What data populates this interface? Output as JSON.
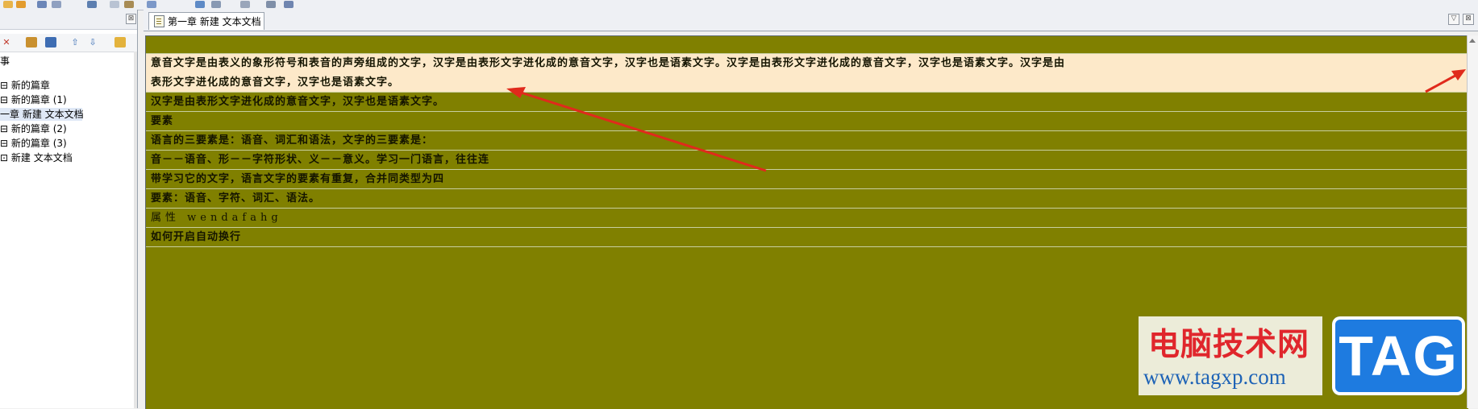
{
  "left_panel": {
    "close_label": "⊠",
    "tree": [
      {
        "label": "事",
        "selected": false
      },
      {
        "label": "新的篇章",
        "selected": false
      },
      {
        "label": "新的篇章 (1)",
        "selected": false
      },
      {
        "label": "一章 新建 文本文档",
        "selected": true
      },
      {
        "label": "新的篇章 (2)",
        "selected": false
      },
      {
        "label": "新的篇章 (3)",
        "selected": false
      },
      {
        "label": "新建 文本文档",
        "selected": false
      }
    ]
  },
  "tab": {
    "label": "第一章 新建 文本文档"
  },
  "editor": {
    "lines": [
      "",
      "意音文字是由表义的象形符号和表音的声旁组成的文字，汉字是由表形文字进化成的意音文字，汉字也是语素文字。汉字是由表形文字进化成的意音文字，汉字也是语素文字。汉字是由",
      "表形文字进化成的意音文字，汉字也是语素文字。",
      "汉字是由表形文字进化成的意音文字，汉字也是语素文字。",
      "要素",
      "语言的三要素是：语音、词汇和语法，文字的三要素是：",
      "音－－语音、形－－字符形状、义－－意义。学习一门语言，往往连",
      "带学习它的文字，语言文字的要素有重复，合并同类型为四",
      "要素：语音、字符、词汇、语法。",
      "属性  wendafahg",
      "如何开启自动换行"
    ]
  },
  "watermark": {
    "title": "电脑技术网",
    "url": "www.tagxp.com",
    "badge": "TAG"
  },
  "colors": {
    "editor_bg": "#808000",
    "highlight_bg": "#fde9c9",
    "annotation_arrow": "#e02a1c"
  }
}
